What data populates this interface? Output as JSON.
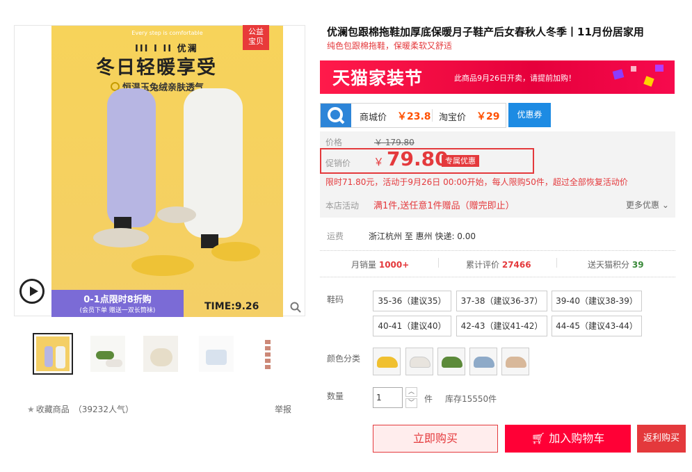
{
  "gallery": {
    "badge": "公益\n宝贝",
    "photo_topbar": "Every step is comfortable",
    "photo_logo": "III I II 优澜",
    "photo_headline": "冬日轻暖享受",
    "photo_subline": "恒温玉兔绒亲肤透气",
    "photo_promo_line1": "0-1点限时8折购",
    "photo_promo_line2": "(会员下单 赠送一双长筒袜)",
    "photo_time": "TIME:9.26",
    "thumbnails": [
      "thumb-1",
      "thumb-2",
      "thumb-3",
      "thumb-4",
      "thumb-5"
    ],
    "favorite_label": "收藏商品",
    "favorite_count": "（39232人气）",
    "report_label": "举报"
  },
  "product": {
    "title": "优澜包跟棉拖鞋加厚底保暖月子鞋产后女春秋人冬季丨11月份居家用",
    "subtitle": "纯色包跟棉拖鞋，保暖柔软又舒适"
  },
  "banner": {
    "brand": "天猫家装节",
    "text": "此商品9月26日开卖，请提前加购！"
  },
  "compare": {
    "mall_label": "商城价",
    "mall_price": "￥23.8",
    "taobao_label": "淘宝价",
    "taobao_price": "￥29",
    "coupon_button": "优惠券"
  },
  "price": {
    "orig_label": "价格",
    "orig_value": "￥ 179.80",
    "promo_label": "促销价",
    "promo_currency": "￥",
    "promo_value": "79.80",
    "promo_tag": "专属优惠",
    "limit_text": "限时71.80元，活动于9月26日 00:00开始，每人限购50件，超过全部恢复活动价",
    "activity_label": "本店活动",
    "activity_value": "满1件,送任意1件赠品（赠完即止）",
    "more_label": "更多优惠"
  },
  "shipping": {
    "label": "运费",
    "value": "浙江杭州  至 惠州  快递: 0.00"
  },
  "stats": {
    "sales_label": "月销量",
    "sales_value": "1000+",
    "reviews_label": "累计评价",
    "reviews_value": "27466",
    "points_label": "送天猫积分",
    "points_value": "39"
  },
  "sizes": {
    "label": "鞋码",
    "options": [
      "35-36（建议35）",
      "37-38（建议36-37）",
      "39-40（建议38-39）",
      "40-41（建议40）",
      "42-43（建议41-42）",
      "44-45（建议43-44）"
    ]
  },
  "colors": {
    "label": "颜色分类",
    "swatches": [
      "#f0c030",
      "#e8e4de",
      "#5c8a3a",
      "#8eaac8",
      "#d8b89a"
    ]
  },
  "quantity": {
    "label": "数量",
    "value": "1",
    "unit": "件",
    "stock": "库存15550件"
  },
  "actions": {
    "buy_now": "立即购买",
    "add_cart": "加入购物车",
    "rebate": "返利购买"
  }
}
